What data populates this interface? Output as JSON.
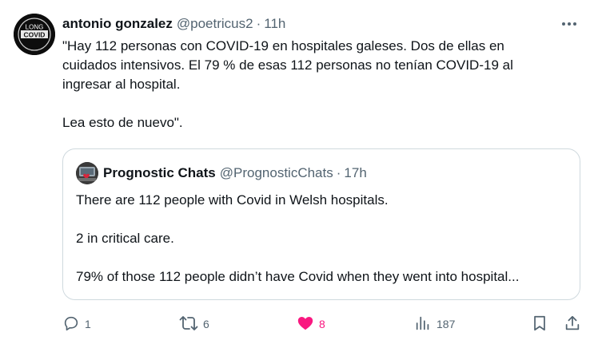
{
  "author": {
    "name": "antonio gonzalez",
    "handle": "@poetricus2",
    "separator": "·",
    "time": "11h",
    "avatar_text_top": "LONG",
    "avatar_text_bottom": "COVID"
  },
  "tweet": {
    "text": "\"Hay 112 personas con COVID-19 en hospitales galeses. Dos de ellas en\ncuidados intensivos. El 79 % de esas 112 personas no tenían COVID-19 al\ningresar al hospital.\n\nLea esto de nuevo\"."
  },
  "quote": {
    "name": "Prognostic Chats",
    "handle": "@PrognosticChats",
    "separator": "·",
    "time": "17h",
    "text": "There are 112 people with Covid in Welsh hospitals.\n\n2 in critical care.\n\n79% of those 112 people didn’t have Covid when they went into hospital..."
  },
  "actions": {
    "replies": "1",
    "retweets": "6",
    "likes": "8",
    "views": "187"
  },
  "icons": {
    "more": "more-icon",
    "reply": "reply-icon",
    "retweet": "retweet-icon",
    "like": "heart-icon",
    "views": "views-icon",
    "bookmark": "bookmark-icon",
    "share": "share-icon"
  },
  "colors": {
    "text": "#0f1419",
    "secondary": "#536471",
    "like": "#f91880",
    "border": "#cfd9de"
  }
}
